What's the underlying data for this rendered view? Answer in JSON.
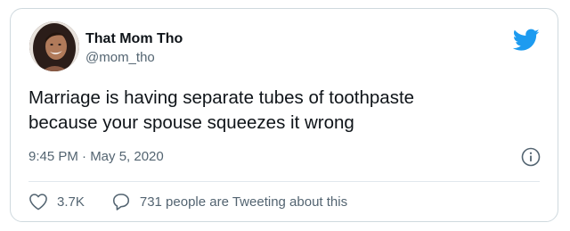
{
  "author": {
    "display_name": "That Mom Tho",
    "handle": "@mom_tho",
    "avatar_icon": "profile-photo"
  },
  "tweet": {
    "text_line_1": "Marriage is having separate tubes of toothpaste",
    "text_line_2": "because your spouse squeezes it wrong",
    "timestamp": "9:45 PM · May 5, 2020"
  },
  "actions": {
    "like_count": "3.7K",
    "conversation_label": "731 people are Tweeting about this"
  },
  "icons": {
    "brand": "twitter-bird-icon",
    "info": "info-icon",
    "like": "heart-icon",
    "reply": "speech-bubble-icon"
  },
  "colors": {
    "brand_blue": "#1d9bf0",
    "text_primary": "#0f1419",
    "text_secondary": "#536471",
    "border": "#cfd9de"
  }
}
